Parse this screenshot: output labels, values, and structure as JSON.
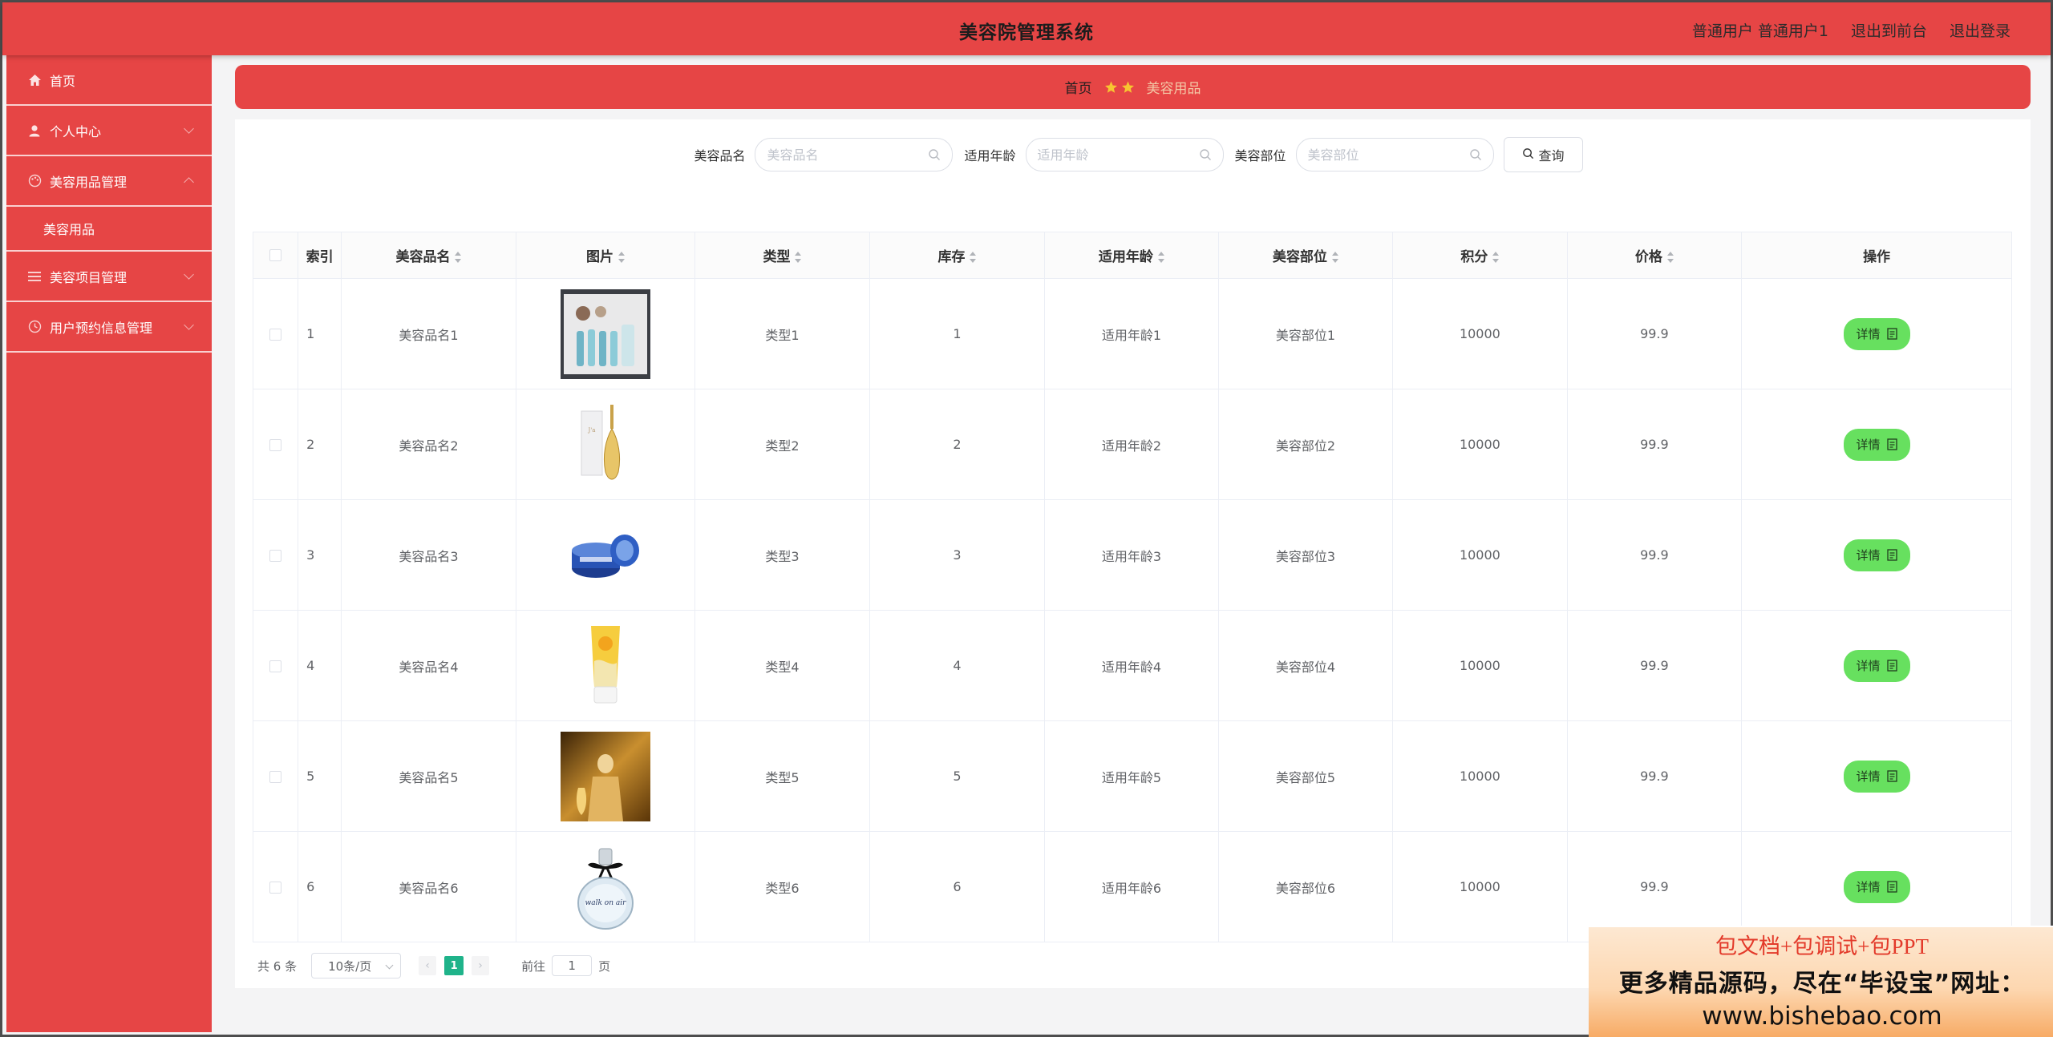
{
  "header": {
    "title": "美容院管理系统",
    "user_label": "普通用户 普通用户1",
    "frontend_link": "退出到前台",
    "logout_link": "退出登录"
  },
  "sidebar": {
    "items": [
      {
        "label": "首页",
        "icon": "home-icon"
      },
      {
        "label": "个人中心",
        "icon": "user-icon"
      },
      {
        "label": "美容用品管理",
        "icon": "palette-icon"
      },
      {
        "label": "美容项目管理",
        "icon": "list-icon"
      },
      {
        "label": "用户预约信息管理",
        "icon": "clock-icon"
      }
    ],
    "submenu": {
      "label": "美容用品"
    }
  },
  "breadcrumb": {
    "home": "首页",
    "current": "美容用品"
  },
  "search": {
    "name_label": "美容品名",
    "name_placeholder": "美容品名",
    "age_label": "适用年龄",
    "age_placeholder": "适用年龄",
    "part_label": "美容部位",
    "part_placeholder": "美容部位",
    "query_button": "查询"
  },
  "table": {
    "columns": [
      "索引",
      "美容品名",
      "图片",
      "类型",
      "库存",
      "适用年龄",
      "美容部位",
      "积分",
      "价格",
      "操作"
    ],
    "detail_label": "详情",
    "rows": [
      {
        "index": "1",
        "name": "美容品名1",
        "image": "skincare-set",
        "type": "类型1",
        "stock": "1",
        "age": "适用年龄1",
        "part": "美容部位1",
        "points": "10000",
        "price": "99.9"
      },
      {
        "index": "2",
        "name": "美容品名2",
        "image": "perfume-bottle-gold",
        "type": "类型2",
        "stock": "2",
        "age": "适用年龄2",
        "part": "美容部位2",
        "points": "10000",
        "price": "99.9"
      },
      {
        "index": "3",
        "name": "美容品名3",
        "image": "blue-cream-jar",
        "type": "类型3",
        "stock": "3",
        "age": "适用年龄3",
        "part": "美容部位3",
        "points": "10000",
        "price": "99.9"
      },
      {
        "index": "4",
        "name": "美容品名4",
        "image": "yellow-sunscreen-tube",
        "type": "类型4",
        "stock": "4",
        "age": "适用年龄4",
        "part": "美容部位4",
        "points": "10000",
        "price": "99.9"
      },
      {
        "index": "5",
        "name": "美容品名5",
        "image": "perfume-ad-gold",
        "type": "类型5",
        "stock": "5",
        "age": "适用年龄5",
        "part": "美容部位5",
        "points": "10000",
        "price": "99.9"
      },
      {
        "index": "6",
        "name": "美容品名6",
        "image": "perfume-bottle-bow",
        "type": "类型6",
        "stock": "6",
        "age": "适用年龄6",
        "part": "美容部位6",
        "points": "10000",
        "price": "99.9"
      }
    ]
  },
  "pagination": {
    "total": "共 6 条",
    "page_size": "10条/页",
    "current_page": "1",
    "prev": "‹",
    "next": "›",
    "goto_label": "前往",
    "goto_value": "1",
    "page_suffix": "页"
  },
  "ad": {
    "line1": "包文档+包调试+包PPT",
    "line2": "更多精品源码，尽在“毕设宝”网址：",
    "line3": "www.bishebao.com"
  },
  "colors": {
    "primary_red": "#e64545",
    "detail_green": "#67e05f",
    "page_active": "#1fb38a"
  }
}
